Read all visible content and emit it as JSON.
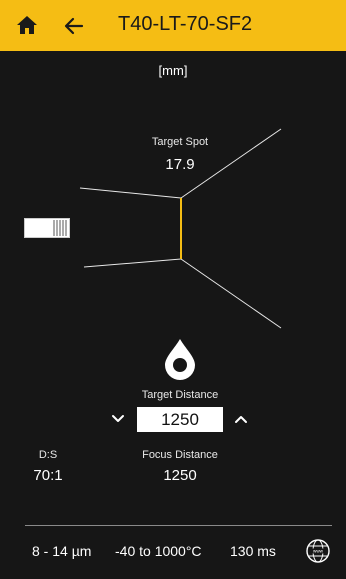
{
  "header": {
    "title": "T40-LT-70-SF2",
    "home_icon": "home-icon",
    "back_icon": "arrow-left-icon"
  },
  "units_label": "[mm]",
  "target_spot": {
    "label": "Target Spot",
    "value": "17.9"
  },
  "target_distance": {
    "label": "Target Distance",
    "value": "1250"
  },
  "ds_ratio": {
    "label": "D:S",
    "value": "70:1"
  },
  "focus_distance": {
    "label": "Focus Distance",
    "value": "1250"
  },
  "footer": {
    "spectral_range": "8 - 14 µm",
    "temperature_range": "-40 to 1000°C",
    "response_time": "130 ms",
    "globe_icon": "www-globe-icon"
  },
  "colors": {
    "header_bg": "#f5bd14",
    "background": "#161616",
    "spot_line": "#f5bd14"
  }
}
